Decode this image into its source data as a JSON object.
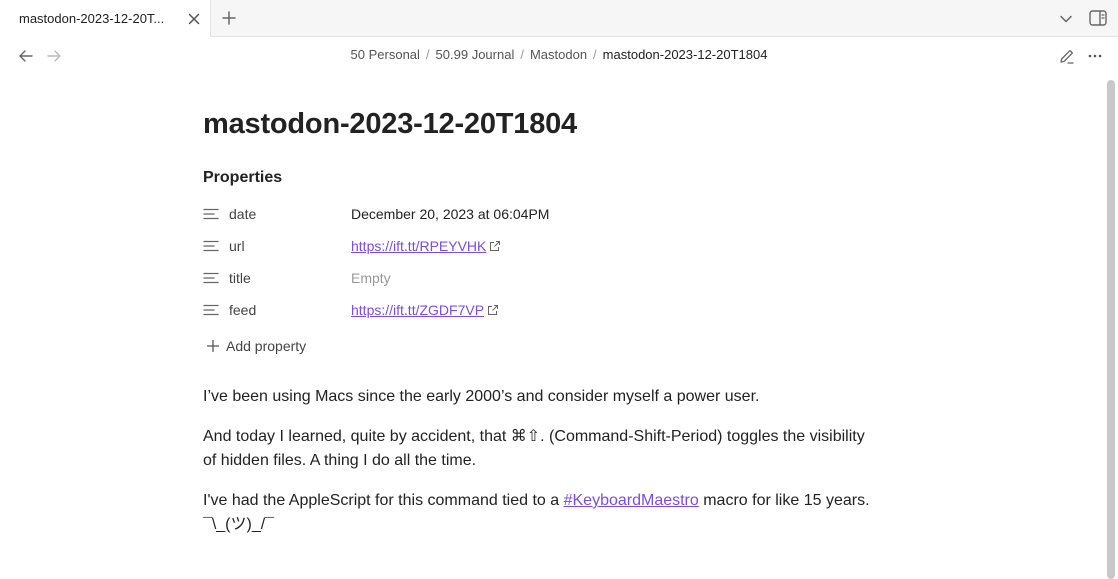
{
  "tab": {
    "title": "mastodon-2023-12-20T..."
  },
  "breadcrumb": {
    "items": [
      "50 Personal",
      "50.99 Journal",
      "Mastodon"
    ],
    "current": "mastodon-2023-12-20T1804",
    "separator": "/"
  },
  "page": {
    "title": "mastodon-2023-12-20T1804"
  },
  "properties": {
    "heading": "Properties",
    "rows": [
      {
        "key": "date",
        "value": "December 20, 2023 at 06:04PM"
      },
      {
        "key": "url",
        "value": "https://ift.tt/RPEYVHK"
      },
      {
        "key": "title",
        "value": "Empty"
      },
      {
        "key": "feed",
        "value": "https://ift.tt/ZGDF7VP"
      }
    ],
    "add_label": "Add property"
  },
  "body": {
    "p1": "I’ve been using Macs since the early 2000’s and consider myself a power user.",
    "p2_line1": "And today I learned, quite by accident, that ⌘⇧. (Command-Shift-Period) toggles the visibility",
    "p2_line2": "of hidden files. A thing I do all the time.",
    "p3_before": "I've had the AppleScript for this command tied to a ",
    "p3_tag": "#KeyboardMaestro",
    "p3_after": " macro for like 15 years.",
    "p3_line2": "¯\\_(ツ)_/¯"
  },
  "colors": {
    "link": "#7b4de0",
    "muted": "#999999",
    "text": "#222222"
  }
}
